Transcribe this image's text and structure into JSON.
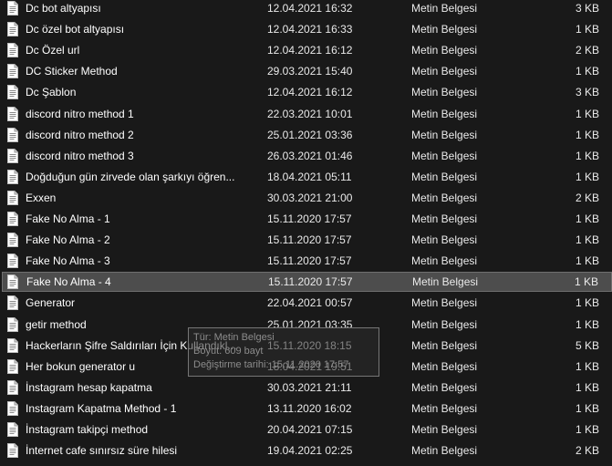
{
  "files": [
    {
      "name": "Dc bot altyapısı",
      "date": "12.04.2021 16:32",
      "type": "Metin Belgesi",
      "size": "3 KB"
    },
    {
      "name": "Dc özel bot altyapısı",
      "date": "12.04.2021 16:33",
      "type": "Metin Belgesi",
      "size": "1 KB"
    },
    {
      "name": "Dc Özel url",
      "date": "12.04.2021 16:12",
      "type": "Metin Belgesi",
      "size": "2 KB"
    },
    {
      "name": "DC Sticker Method",
      "date": "29.03.2021 15:40",
      "type": "Metin Belgesi",
      "size": "1 KB"
    },
    {
      "name": "Dc Şablon",
      "date": "12.04.2021 16:12",
      "type": "Metin Belgesi",
      "size": "3 KB"
    },
    {
      "name": "discord nitro method 1",
      "date": "22.03.2021 10:01",
      "type": "Metin Belgesi",
      "size": "1 KB"
    },
    {
      "name": "discord nitro method 2",
      "date": "25.01.2021 03:36",
      "type": "Metin Belgesi",
      "size": "1 KB"
    },
    {
      "name": "discord nitro method 3",
      "date": "26.03.2021 01:46",
      "type": "Metin Belgesi",
      "size": "1 KB"
    },
    {
      "name": "Doğduğun gün zirvede olan şarkıyı öğren...",
      "date": "18.04.2021 05:11",
      "type": "Metin Belgesi",
      "size": "1 KB"
    },
    {
      "name": "Exxen",
      "date": "30.03.2021 21:00",
      "type": "Metin Belgesi",
      "size": "2 KB"
    },
    {
      "name": "Fake No Alma - 1",
      "date": "15.11.2020 17:57",
      "type": "Metin Belgesi",
      "size": "1 KB"
    },
    {
      "name": "Fake No Alma - 2",
      "date": "15.11.2020 17:57",
      "type": "Metin Belgesi",
      "size": "1 KB"
    },
    {
      "name": "Fake No Alma - 3",
      "date": "15.11.2020 17:57",
      "type": "Metin Belgesi",
      "size": "1 KB"
    },
    {
      "name": "Fake No Alma - 4",
      "date": "15.11.2020 17:57",
      "type": "Metin Belgesi",
      "size": "1 KB",
      "selected": true
    },
    {
      "name": "Generator",
      "date": "22.04.2021 00:57",
      "type": "Metin Belgesi",
      "size": "1 KB"
    },
    {
      "name": "getir method",
      "date": "25.01.2021 03:35",
      "type": "Metin Belgesi",
      "size": "1 KB"
    },
    {
      "name": "Hackerların Şifre Saldırıları İçin Kullandıkl...",
      "date": "15.11.2020 18:15",
      "type": "Metin Belgesi",
      "size": "5 KB"
    },
    {
      "name": "Her bokun generator u",
      "date": "18.04.2021 19:51",
      "type": "Metin Belgesi",
      "size": "1 KB"
    },
    {
      "name": "İnstagram hesap kapatma",
      "date": "30.03.2021 21:11",
      "type": "Metin Belgesi",
      "size": "1 KB"
    },
    {
      "name": "Instagram Kapatma Method - 1",
      "date": "13.11.2020 16:02",
      "type": "Metin Belgesi",
      "size": "1 KB"
    },
    {
      "name": "İnstagram takipçi method",
      "date": "20.04.2021 07:15",
      "type": "Metin Belgesi",
      "size": "1 KB"
    },
    {
      "name": "İnternet cafe sınırsız süre hilesi",
      "date": "19.04.2021 02:25",
      "type": "Metin Belgesi",
      "size": "2 KB"
    }
  ],
  "tooltip": {
    "type_line": "Tür: Metin Belgesi",
    "size_line": "Boyut: 609 bayt",
    "modified_line": "Değiştirme tarihi: 15.11.2020 17:57"
  },
  "icons": {
    "file": "text-document-icon"
  },
  "colors": {
    "background": "#191919",
    "selected_row": "#4d4d4d",
    "text": "#ffffff"
  }
}
